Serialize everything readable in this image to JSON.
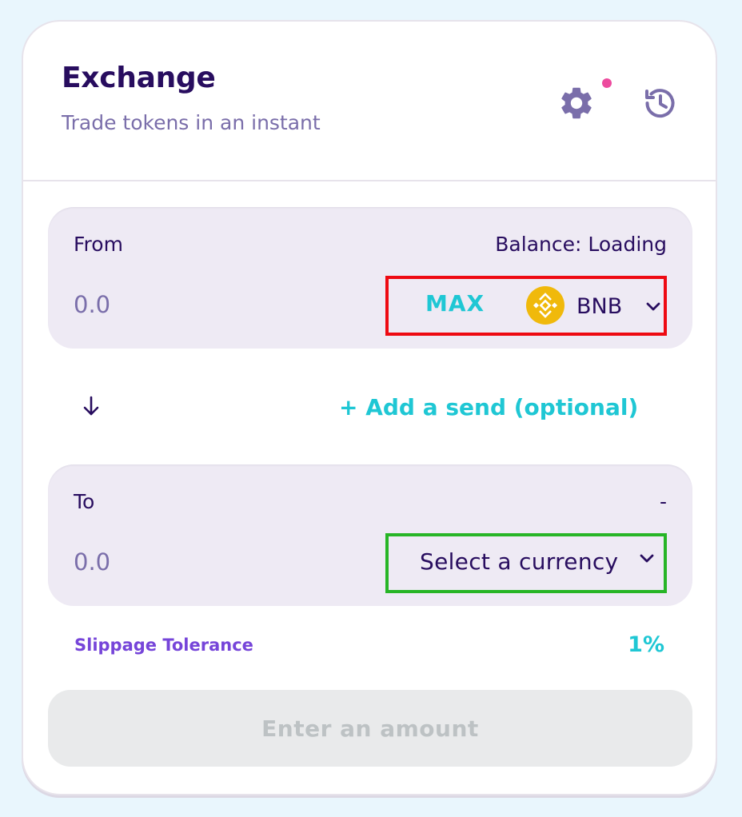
{
  "header": {
    "title": "Exchange",
    "subtitle": "Trade tokens in an instant",
    "icons": [
      "gear-icon",
      "history-icon"
    ]
  },
  "from": {
    "label": "From",
    "balance": "Balance: Loading",
    "amount_placeholder": "0.0",
    "max_label": "MAX",
    "token_symbol": "BNB",
    "token_icon": "bnb-logo-icon"
  },
  "middle": {
    "arrow_icon": "arrow-down-icon",
    "add_send_label": "+ Add a send (optional)"
  },
  "to": {
    "label": "To",
    "right_text": "-",
    "amount_placeholder": "0.0",
    "select_label": "Select a currency"
  },
  "slippage": {
    "label": "Slippage Tolerance",
    "value": "1%"
  },
  "submit": {
    "label": "Enter an amount"
  },
  "colors": {
    "primary_text": "#280d5f",
    "secondary_text": "#7a6eaa",
    "accent": "#1fc7d4",
    "purple": "#7645d9",
    "notification_dot": "#ed4b9e",
    "bnb_yellow": "#f0b90b",
    "highlight_red": "#ee0a12",
    "highlight_green": "#27b526"
  }
}
